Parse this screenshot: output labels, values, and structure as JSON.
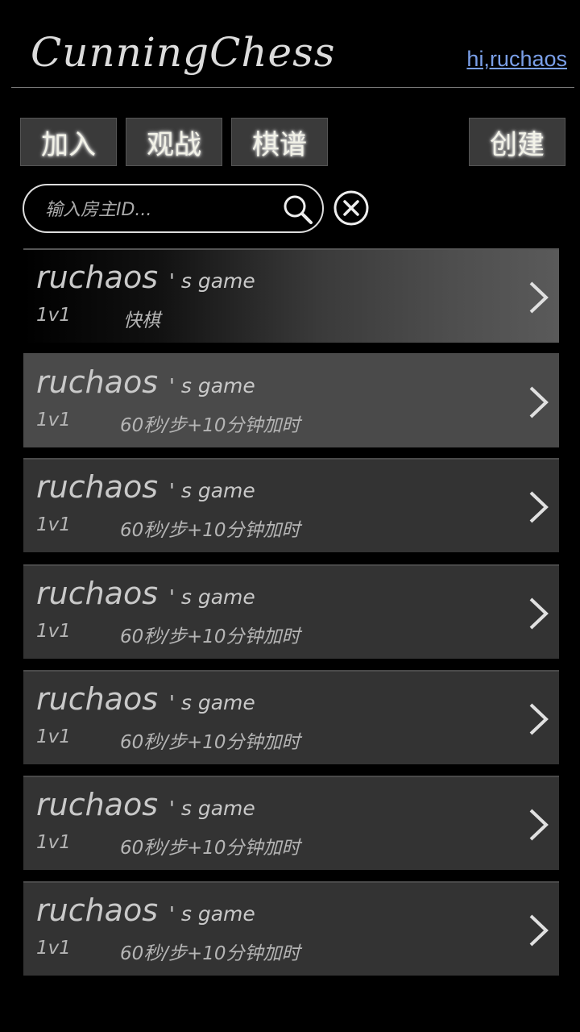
{
  "header": {
    "logo": "CunningChess",
    "user_link": "hi,ruchaos"
  },
  "toolbar": {
    "join_label": "加入",
    "watch_label": "观战",
    "record_label": "棋谱",
    "create_label": "创建"
  },
  "search": {
    "placeholder": "输入房主ID...",
    "value": ""
  },
  "games": [
    {
      "title": "ruchaos",
      "suffix": "' s game",
      "mode": "1v1",
      "time": "快棋"
    },
    {
      "title": "ruchaos",
      "suffix": "' s game",
      "mode": "1v1",
      "time": "60秒/步+10分钟加时"
    },
    {
      "title": "ruchaos",
      "suffix": "' s game",
      "mode": "1v1",
      "time": "60秒/步+10分钟加时"
    },
    {
      "title": "ruchaos",
      "suffix": "' s game",
      "mode": "1v1",
      "time": "60秒/步+10分钟加时"
    },
    {
      "title": "ruchaos",
      "suffix": "' s game",
      "mode": "1v1",
      "time": "60秒/步+10分钟加时"
    },
    {
      "title": "ruchaos",
      "suffix": "' s game",
      "mode": "1v1",
      "time": "60秒/步+10分钟加时"
    },
    {
      "title": "ruchaos",
      "suffix": "' s game",
      "mode": "1v1",
      "time": "60秒/步+10分钟加时"
    }
  ],
  "icons": {
    "search": "search-icon",
    "clear": "close-circle-icon",
    "row_arrow": "chevron-right-icon"
  }
}
